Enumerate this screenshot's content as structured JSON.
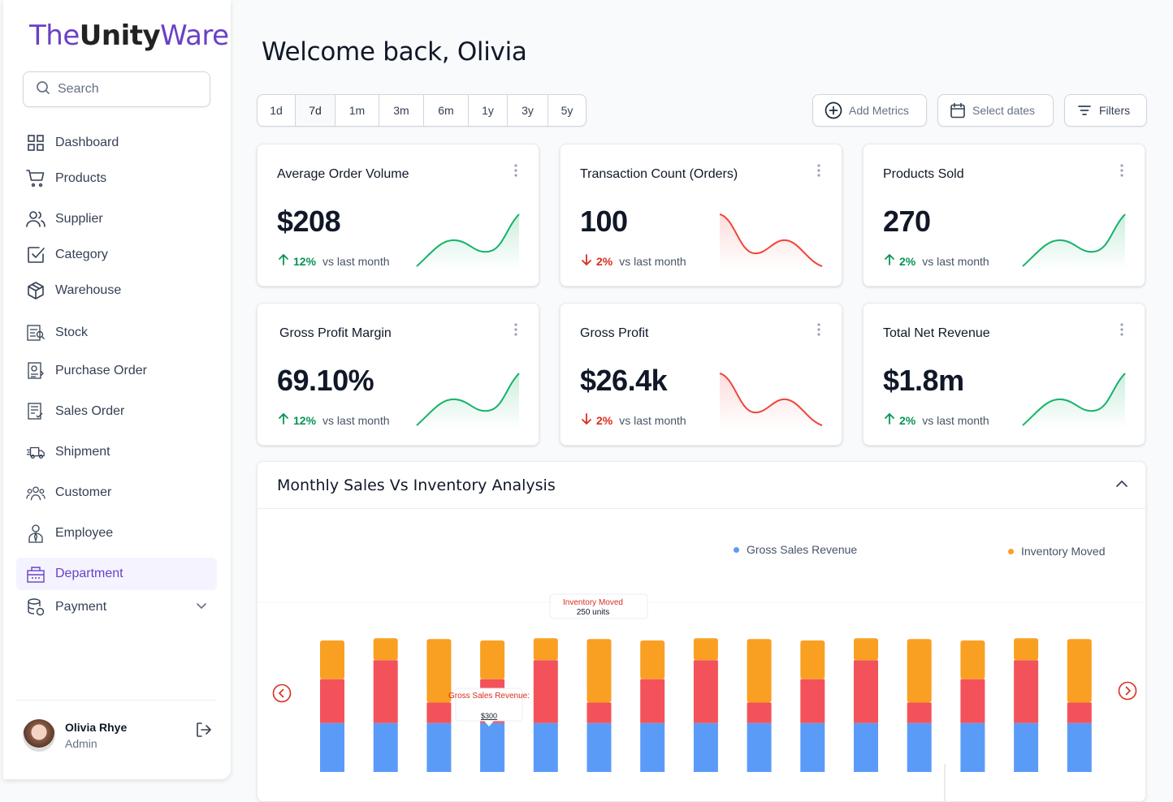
{
  "brand": {
    "prefix": "The",
    "middle": "Unity",
    "suffix": "Ware"
  },
  "search": {
    "placeholder": "Search"
  },
  "sidebar": {
    "items": [
      {
        "label": "Dashboard",
        "icon": "grid-icon"
      },
      {
        "label": "Products",
        "icon": "cart-icon"
      },
      {
        "label": "Supplier",
        "icon": "users-icon"
      },
      {
        "label": "Category",
        "icon": "check-square-icon"
      },
      {
        "label": "Warehouse",
        "icon": "box-icon"
      },
      {
        "label": "Stock",
        "icon": "stock-icon"
      },
      {
        "label": "Purchase Order",
        "icon": "purchase-order-icon"
      },
      {
        "label": "Sales Order",
        "icon": "sales-order-icon"
      },
      {
        "label": "Shipment",
        "icon": "truck-icon"
      },
      {
        "label": "Customer",
        "icon": "customer-icon"
      },
      {
        "label": "Employee",
        "icon": "employee-icon"
      },
      {
        "label": "Department",
        "icon": "department-icon",
        "active": true
      },
      {
        "label": "Payment",
        "icon": "database-icon",
        "expandable": true
      }
    ]
  },
  "user": {
    "name": "Olivia Rhye",
    "role": "Admin"
  },
  "header": {
    "title": "Welcome back, Olivia"
  },
  "time_ranges": {
    "options": [
      "1d",
      "7d",
      "1m",
      "3m",
      "6m",
      "1y",
      "3y",
      "5y"
    ],
    "selected": "7d"
  },
  "toolbar": {
    "add_metrics": "Add Metrics",
    "select_dates": "Select dates",
    "filters": "Filters"
  },
  "colors": {
    "accent": "#6941c6",
    "up": "#079455",
    "down": "#d92d20",
    "blue": "#5b9bf8",
    "red": "#f4525a",
    "orange": "#f9a023"
  },
  "metrics": [
    {
      "title": "Average Order Volume",
      "value": "$208",
      "change": "12%",
      "trend": "up",
      "comparison": "vs last month"
    },
    {
      "title": "Transaction Count (Orders)",
      "value": "100",
      "change": "2%",
      "trend": "down",
      "comparison": "vs last month"
    },
    {
      "title": "Products Sold",
      "value": "270",
      "change": "2%",
      "trend": "up",
      "comparison": "vs last month"
    },
    {
      "title": "Gross Profit Margin",
      "value": "69.10%",
      "change": "12%",
      "trend": "up",
      "comparison": "vs last month"
    },
    {
      "title": "Gross Profit",
      "value": "$26.4k",
      "change": "2%",
      "trend": "down",
      "comparison": "vs last month"
    },
    {
      "title": "Total Net Revenue",
      "value": "$1.8m",
      "change": "2%",
      "trend": "up",
      "comparison": "vs last month"
    }
  ],
  "analysis": {
    "title": "Monthly Sales Vs Inventory Analysis",
    "legend": {
      "gross_sales": "Gross Sales Revenue",
      "inventory": "Inventory Moved"
    },
    "tooltip_inventory": {
      "label": "Inventory Moved",
      "value": "250 units"
    },
    "tooltip_sales": {
      "label": "Gross Sales Revenue:",
      "value": "$300"
    }
  },
  "chart_data": {
    "type": "bar",
    "stacked": true,
    "categories": [
      "",
      "",
      "",
      "",
      "",
      "",
      "",
      "",
      "",
      "",
      "",
      "",
      "",
      "",
      ""
    ],
    "series": [
      {
        "name": "Blue",
        "color": "#5b9bf8",
        "values": [
          67,
          67,
          67,
          67,
          67,
          67,
          67,
          67,
          67,
          67,
          67,
          67,
          67,
          67,
          67
        ]
      },
      {
        "name": "Red",
        "color": "#f4525a",
        "values": [
          60,
          86,
          28,
          60,
          86,
          28,
          60,
          86,
          28,
          60,
          86,
          28,
          60,
          86,
          28
        ]
      },
      {
        "name": "Orange",
        "color": "#f9a023",
        "values": [
          53,
          30,
          87,
          53,
          30,
          87,
          53,
          30,
          87,
          53,
          30,
          87,
          53,
          30,
          87
        ]
      }
    ],
    "legend_position": "top-right",
    "grid": false
  }
}
